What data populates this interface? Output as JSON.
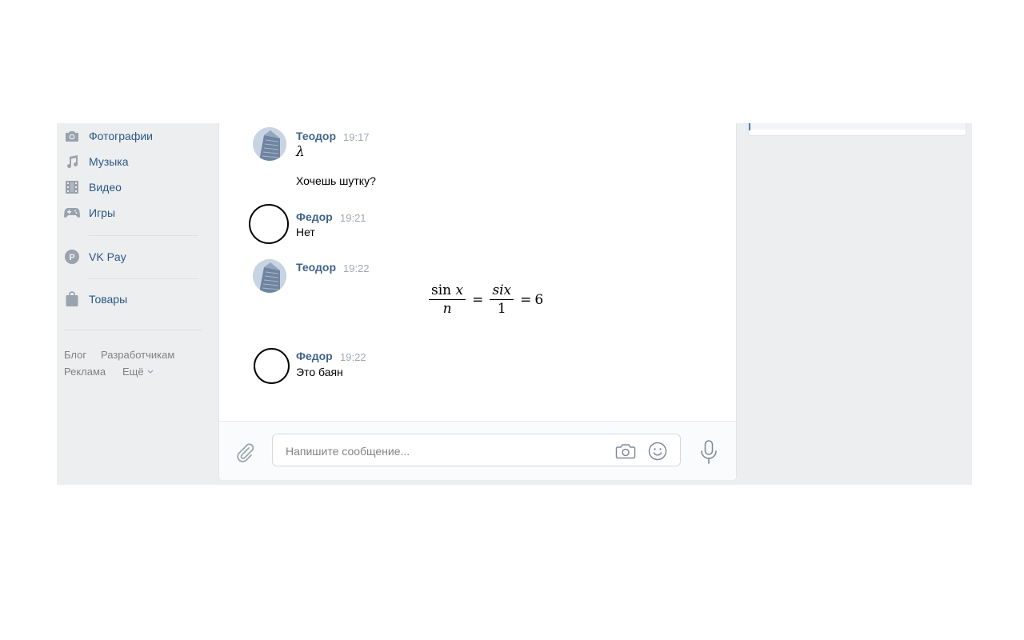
{
  "nav": {
    "items": [
      {
        "label": "Фотографии",
        "icon": "camera-icon"
      },
      {
        "label": "Музыка",
        "icon": "music-note-icon"
      },
      {
        "label": "Видео",
        "icon": "film-icon"
      },
      {
        "label": "Игры",
        "icon": "gamepad-icon"
      },
      {
        "label": "VK Pay",
        "icon": "vk-pay-icon"
      },
      {
        "label": "Товары",
        "icon": "shopping-bag-icon"
      }
    ],
    "footer": [
      "Блог",
      "Разработчикам",
      "Реклама",
      "Ещё"
    ]
  },
  "messages": [
    {
      "author": "Теодор",
      "time": "19:17",
      "lines": [
        "λ",
        "Хочешь шутку?"
      ]
    },
    {
      "author": "Федор",
      "time": "19:21",
      "lines": [
        "Нет"
      ]
    },
    {
      "author": "Теодор",
      "time": "19:22",
      "formula": {
        "num1": "sin",
        "var1": "x",
        "den1": "n",
        "num2": "six",
        "den2": "1",
        "result": "6",
        "eq": "="
      }
    },
    {
      "author": "Федор",
      "time": "19:22",
      "lines": [
        "Это баян"
      ]
    }
  ],
  "composer": {
    "placeholder": "Напишите сообщение..."
  },
  "colors": {
    "accent": "#5181b8",
    "author": "#42648b",
    "page_bg": "#edeef0"
  }
}
